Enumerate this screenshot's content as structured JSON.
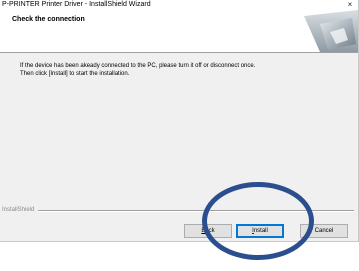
{
  "window": {
    "title": "P-PRINTER Printer Driver - InstallShield Wizard",
    "close_glyph": "×"
  },
  "header": {
    "title": "Check the connection",
    "graphic_icon": "monitor-corner-icon"
  },
  "content": {
    "line1": "If the device has been akeady connected to the PC, please turn it off or disconnect once.",
    "line2": "Then click [Install] to start the installation."
  },
  "footer": {
    "brand": "InstallShield",
    "buttons": {
      "back": {
        "mnemonic": "B",
        "rest": "ack"
      },
      "install": {
        "pre": "",
        "mnemonic": "I",
        "rest": "nstall"
      },
      "cancel": {
        "label": "Cancel"
      }
    }
  },
  "annotation": {
    "ring_color": "#2b4f8e"
  }
}
